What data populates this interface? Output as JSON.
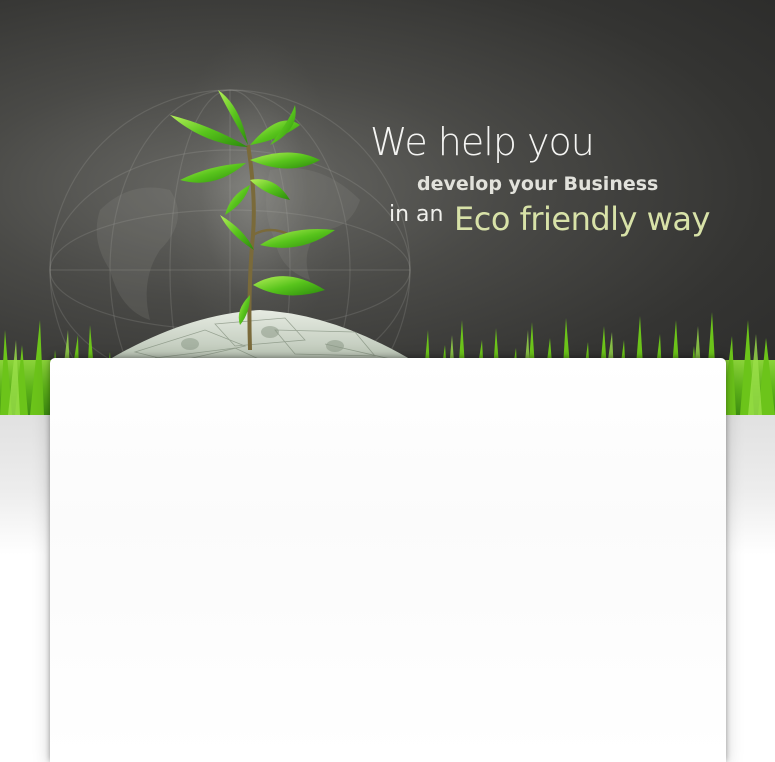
{
  "hero": {
    "headline_line1": "We help you",
    "headline_line2": "develop your Business",
    "headline_line3_prefix": "in an",
    "headline_line3_highlight": "Eco friendly way"
  },
  "colors": {
    "hero_background": "#343432",
    "headline_text": "#f4f4f2",
    "highlight_text": "#d8e2a8",
    "grass_green": "#6cc41a",
    "panel_background": "#ffffff"
  },
  "images": {
    "plant": "green-sapling-icon",
    "globe": "globe-icon",
    "money": "dollar-bills-mound"
  }
}
